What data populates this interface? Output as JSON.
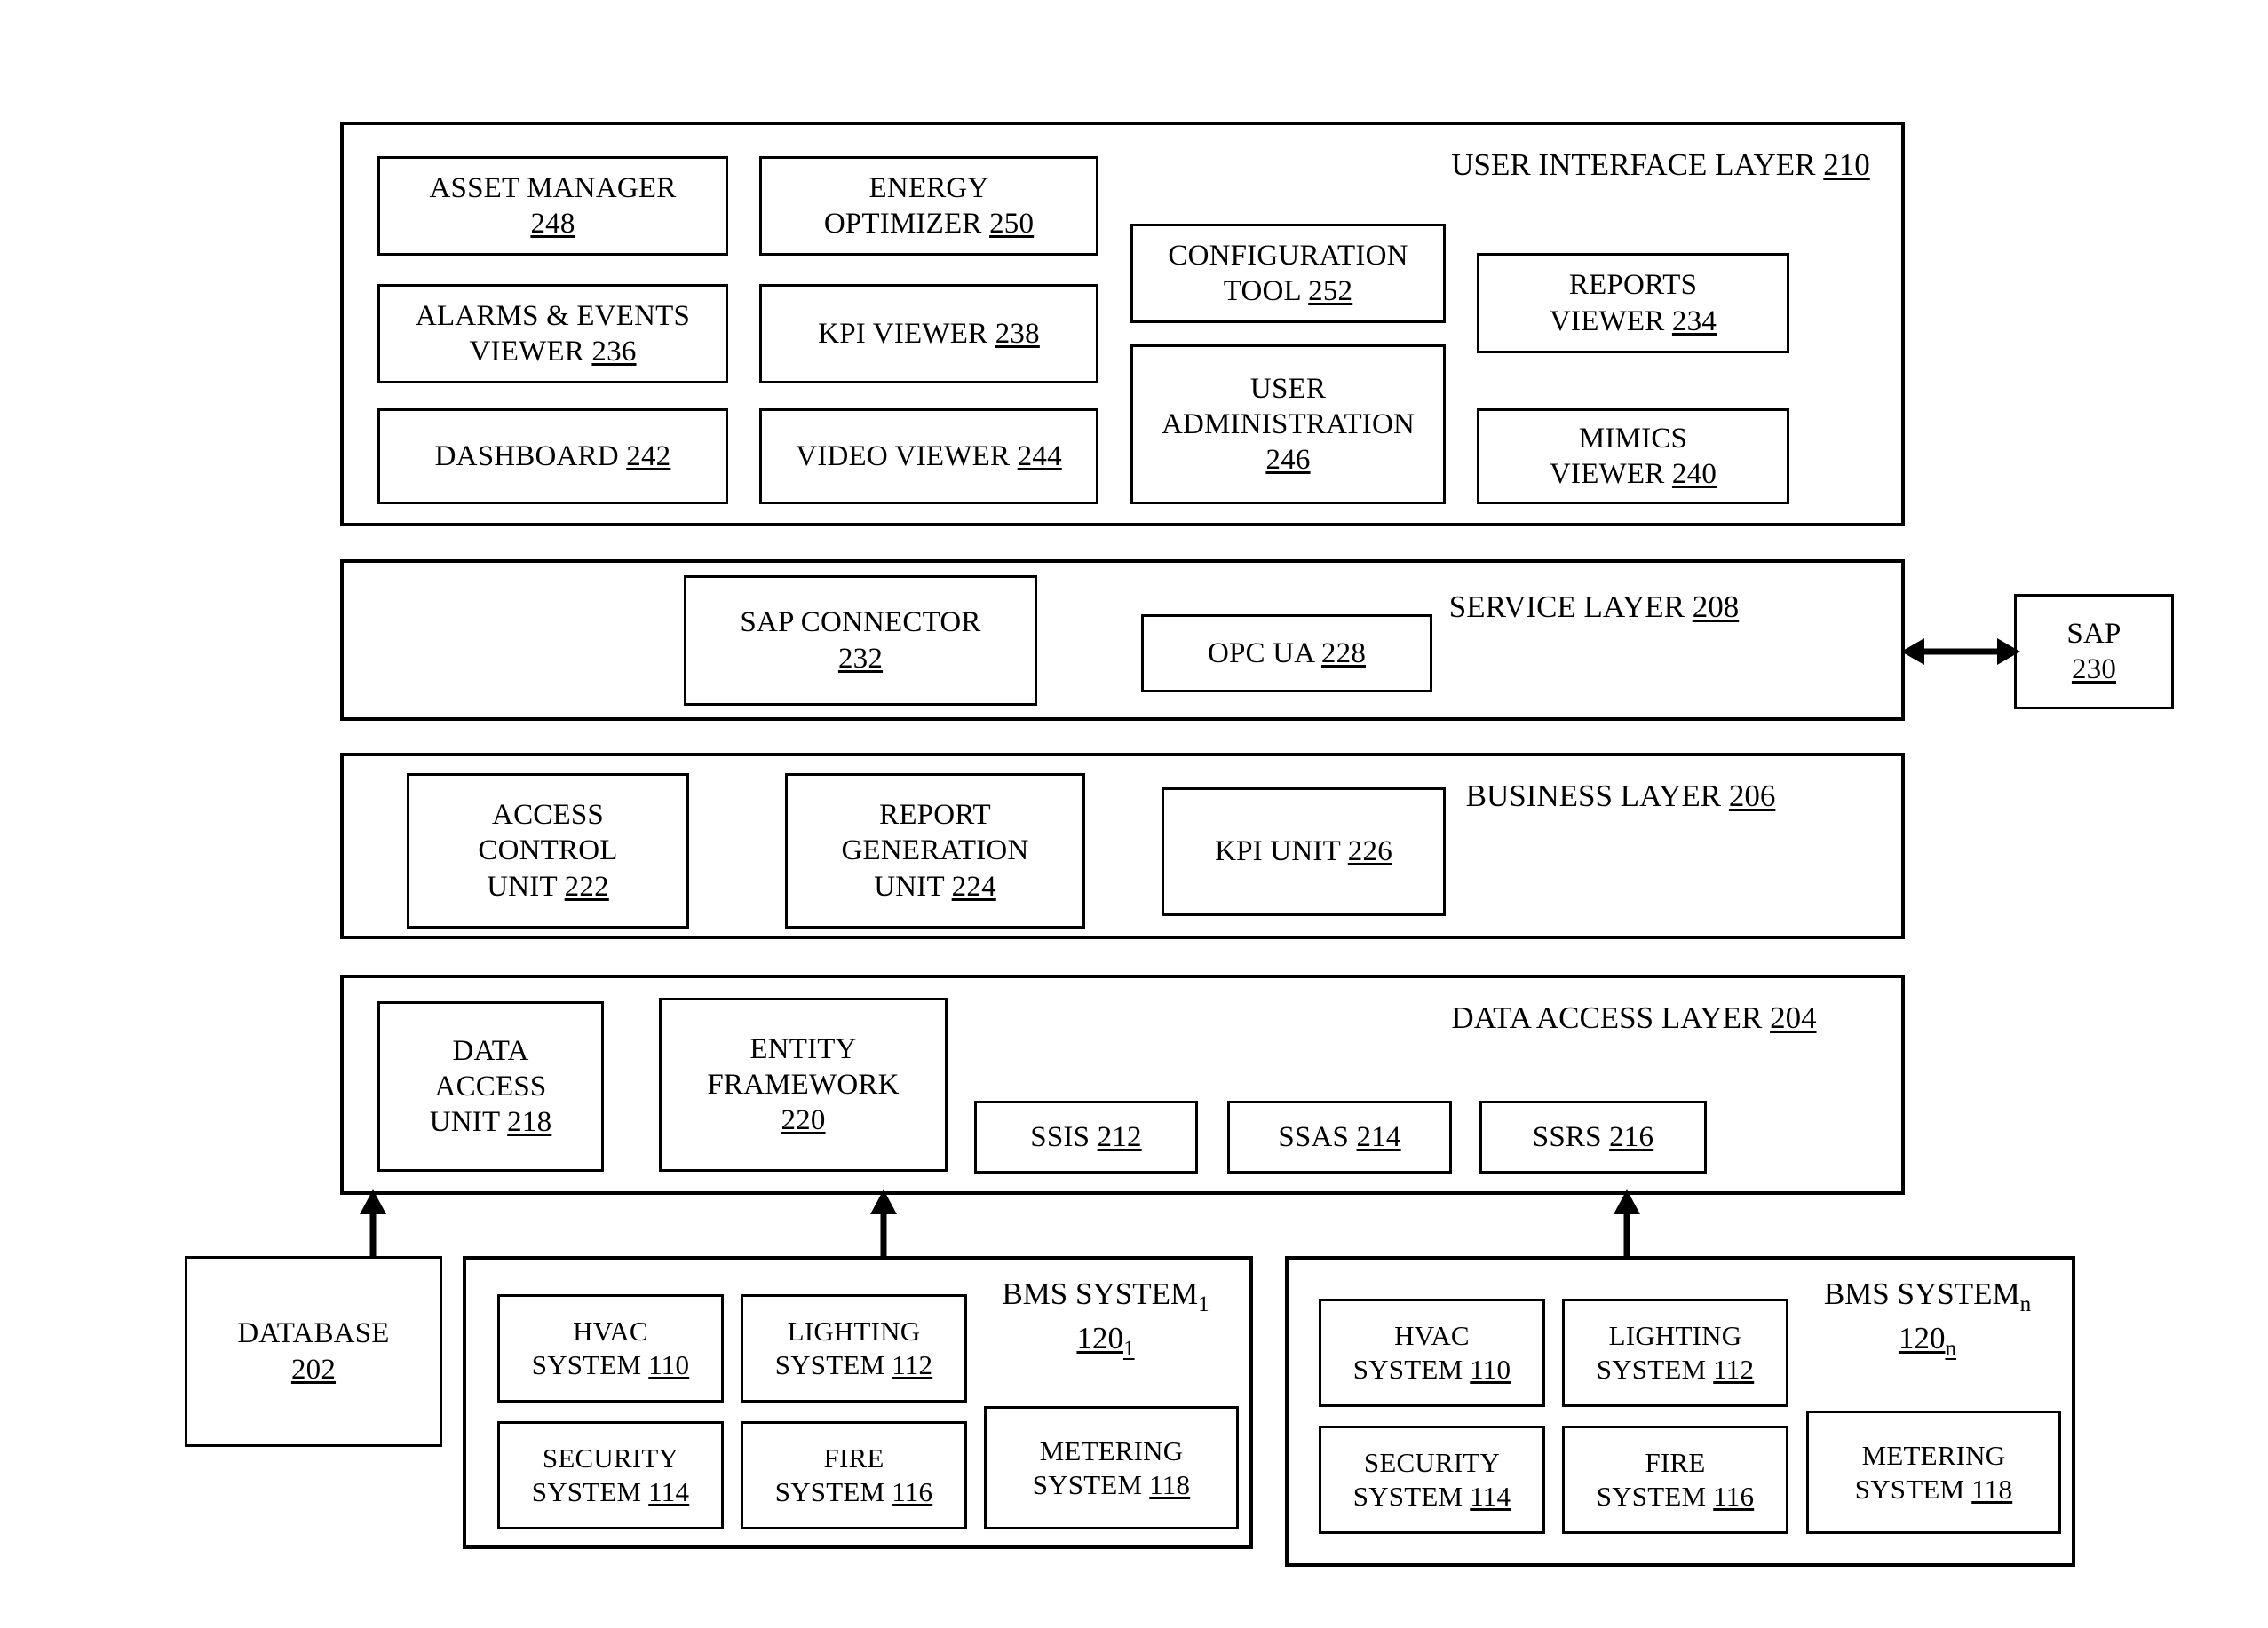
{
  "diagram": {
    "title": "Building Management System layered architecture block diagram",
    "layers": [
      {
        "id": "user_interface_layer",
        "title": "USER INTERFACE LAYER",
        "ref": "210",
        "blocks": [
          {
            "id": "asset_manager",
            "lines": [
              "ASSET MANAGER"
            ],
            "ref": "248",
            "ref_on_new_line": true
          },
          {
            "id": "energy_optimizer",
            "lines": [
              "ENERGY",
              "OPTIMIZER"
            ],
            "ref": "250",
            "ref_on_new_line": false
          },
          {
            "id": "configuration_tool",
            "lines": [
              "CONFIGURATION",
              "TOOL"
            ],
            "ref": "252",
            "ref_on_new_line": false
          },
          {
            "id": "reports_viewer",
            "lines": [
              "REPORTS",
              "VIEWER"
            ],
            "ref": "234",
            "ref_on_new_line": false
          },
          {
            "id": "alarms_events_viewer",
            "lines": [
              "ALARMS & EVENTS",
              "VIEWER"
            ],
            "ref": "236",
            "ref_on_new_line": false
          },
          {
            "id": "kpi_viewer",
            "lines": [
              "KPI VIEWER"
            ],
            "ref": "238",
            "ref_on_new_line": false
          },
          {
            "id": "user_administration",
            "lines": [
              "USER",
              "ADMINISTRATION"
            ],
            "ref": "246",
            "ref_on_new_line": true
          },
          {
            "id": "mimics_viewer",
            "lines": [
              "MIMICS",
              "VIEWER"
            ],
            "ref": "240",
            "ref_on_new_line": false
          },
          {
            "id": "dashboard",
            "lines": [
              "DASHBOARD"
            ],
            "ref": "242",
            "ref_on_new_line": false
          },
          {
            "id": "video_viewer",
            "lines": [
              "VIDEO VIEWER"
            ],
            "ref": "244",
            "ref_on_new_line": false
          }
        ]
      },
      {
        "id": "service_layer",
        "title": "SERVICE LAYER",
        "ref": "208",
        "blocks": [
          {
            "id": "sap_connector",
            "lines": [
              "SAP CONNECTOR"
            ],
            "ref": "232",
            "ref_on_new_line": true
          },
          {
            "id": "opc_ua",
            "lines": [
              "OPC UA"
            ],
            "ref": "228",
            "ref_on_new_line": false
          }
        ]
      },
      {
        "id": "business_layer",
        "title": "BUSINESS LAYER",
        "ref": "206",
        "blocks": [
          {
            "id": "access_control_unit",
            "lines": [
              "ACCESS",
              "CONTROL",
              "UNIT"
            ],
            "ref": "222",
            "ref_on_new_line": false
          },
          {
            "id": "report_generation_unit",
            "lines": [
              "REPORT",
              "GENERATION",
              "UNIT"
            ],
            "ref": "224",
            "ref_on_new_line": false
          },
          {
            "id": "kpi_unit",
            "lines": [
              "KPI UNIT"
            ],
            "ref": "226",
            "ref_on_new_line": false
          }
        ]
      },
      {
        "id": "data_access_layer",
        "title": "DATA ACCESS LAYER",
        "ref": "204",
        "blocks": [
          {
            "id": "data_access_unit",
            "lines": [
              "DATA",
              "ACCESS",
              "UNIT"
            ],
            "ref": "218",
            "ref_on_new_line": false
          },
          {
            "id": "entity_framework",
            "lines": [
              "ENTITY",
              "FRAMEWORK"
            ],
            "ref": "220",
            "ref_on_new_line": true
          },
          {
            "id": "ssis",
            "lines": [
              "SSIS"
            ],
            "ref": "212",
            "ref_on_new_line": false
          },
          {
            "id": "ssas",
            "lines": [
              "SSAS"
            ],
            "ref": "214",
            "ref_on_new_line": false
          },
          {
            "id": "ssrs",
            "lines": [
              "SSRS"
            ],
            "ref": "216",
            "ref_on_new_line": false
          }
        ]
      }
    ],
    "external": {
      "sap": {
        "id": "sap",
        "lines": [
          "SAP"
        ],
        "ref": "230",
        "ref_on_new_line": true
      },
      "database": {
        "id": "database",
        "lines": [
          "DATABASE"
        ],
        "ref": "202",
        "ref_on_new_line": true
      }
    },
    "bms_systems": [
      {
        "id": "bms_system_1",
        "title": "BMS SYSTEM",
        "title_sub": "1",
        "ref": "120",
        "ref_sub": "1",
        "blocks": [
          {
            "id": "hvac_system",
            "lines": [
              "HVAC",
              "SYSTEM"
            ],
            "ref": "110"
          },
          {
            "id": "lighting_system",
            "lines": [
              "LIGHTING",
              "SYSTEM"
            ],
            "ref": "112"
          },
          {
            "id": "security_system",
            "lines": [
              "SECURITY",
              "SYSTEM"
            ],
            "ref": "114"
          },
          {
            "id": "fire_system",
            "lines": [
              "FIRE",
              "SYSTEM"
            ],
            "ref": "116"
          },
          {
            "id": "metering_system",
            "lines": [
              "METERING",
              "SYSTEM"
            ],
            "ref": "118"
          }
        ]
      },
      {
        "id": "bms_system_n",
        "title": "BMS SYSTEM",
        "title_sub": "n",
        "ref": "120",
        "ref_sub": "n",
        "blocks": [
          {
            "id": "hvac_system",
            "lines": [
              "HVAC",
              "SYSTEM"
            ],
            "ref": "110"
          },
          {
            "id": "lighting_system",
            "lines": [
              "LIGHTING",
              "SYSTEM"
            ],
            "ref": "112"
          },
          {
            "id": "security_system",
            "lines": [
              "SECURITY",
              "SYSTEM"
            ],
            "ref": "114"
          },
          {
            "id": "fire_system",
            "lines": [
              "FIRE",
              "SYSTEM"
            ],
            "ref": "116"
          },
          {
            "id": "metering_system",
            "lines": [
              "METERING",
              "SYSTEM"
            ],
            "ref": "118"
          }
        ]
      }
    ],
    "connectors": [
      {
        "id": "service-layer-to-sap",
        "type": "double-arrow-horizontal"
      },
      {
        "id": "data-access-layer-to-database",
        "type": "double-arrow-vertical"
      },
      {
        "id": "data-access-layer-to-bms-system-1",
        "type": "double-arrow-vertical"
      },
      {
        "id": "data-access-layer-to-bms-system-n",
        "type": "double-arrow-vertical"
      }
    ],
    "colors": {
      "line": "#000000",
      "background": "#ffffff",
      "text": "#000000"
    }
  }
}
